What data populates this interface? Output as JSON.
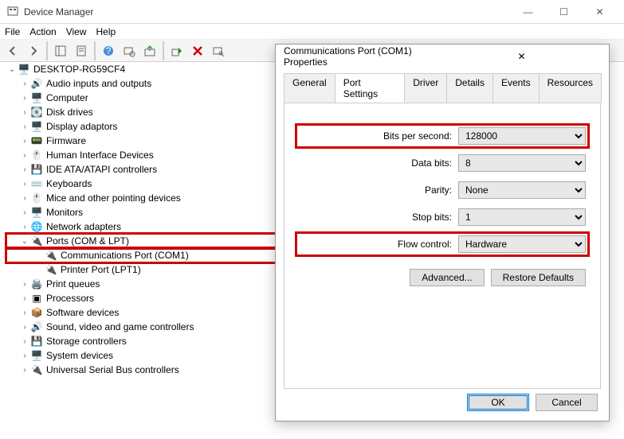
{
  "window": {
    "title": "Device Manager",
    "controls": {
      "min": "—",
      "max": "☐",
      "close": "✕"
    }
  },
  "menu": {
    "file": "File",
    "action": "Action",
    "view": "View",
    "help": "Help"
  },
  "root": "DESKTOP-RG59CF4",
  "devices": [
    "Audio inputs and outputs",
    "Computer",
    "Disk drives",
    "Display adaptors",
    "Firmware",
    "Human Interface Devices",
    "IDE ATA/ATAPI controllers",
    "Keyboards",
    "Mice and other pointing devices",
    "Monitors",
    "Network adapters"
  ],
  "ports_label": "Ports (COM & LPT)",
  "ports_children": [
    "Communications Port (COM1)",
    "Printer Port (LPT1)"
  ],
  "devices_after": [
    "Print queues",
    "Processors",
    "Software devices",
    "Sound, video and game controllers",
    "Storage controllers",
    "System devices",
    "Universal Serial Bus controllers"
  ],
  "dialog": {
    "title": "Communications Port (COM1) Properties",
    "close": "✕",
    "tabs": [
      "General",
      "Port Settings",
      "Driver",
      "Details",
      "Events",
      "Resources"
    ],
    "fields": {
      "bps_label": "Bits per second:",
      "bps_value": "128000",
      "databits_label": "Data bits:",
      "databits_value": "8",
      "parity_label": "Parity:",
      "parity_value": "None",
      "stopbits_label": "Stop bits:",
      "stopbits_value": "1",
      "flow_label": "Flow control:",
      "flow_value": "Hardware"
    },
    "advanced": "Advanced...",
    "restore": "Restore Defaults",
    "ok": "OK",
    "cancel": "Cancel"
  }
}
